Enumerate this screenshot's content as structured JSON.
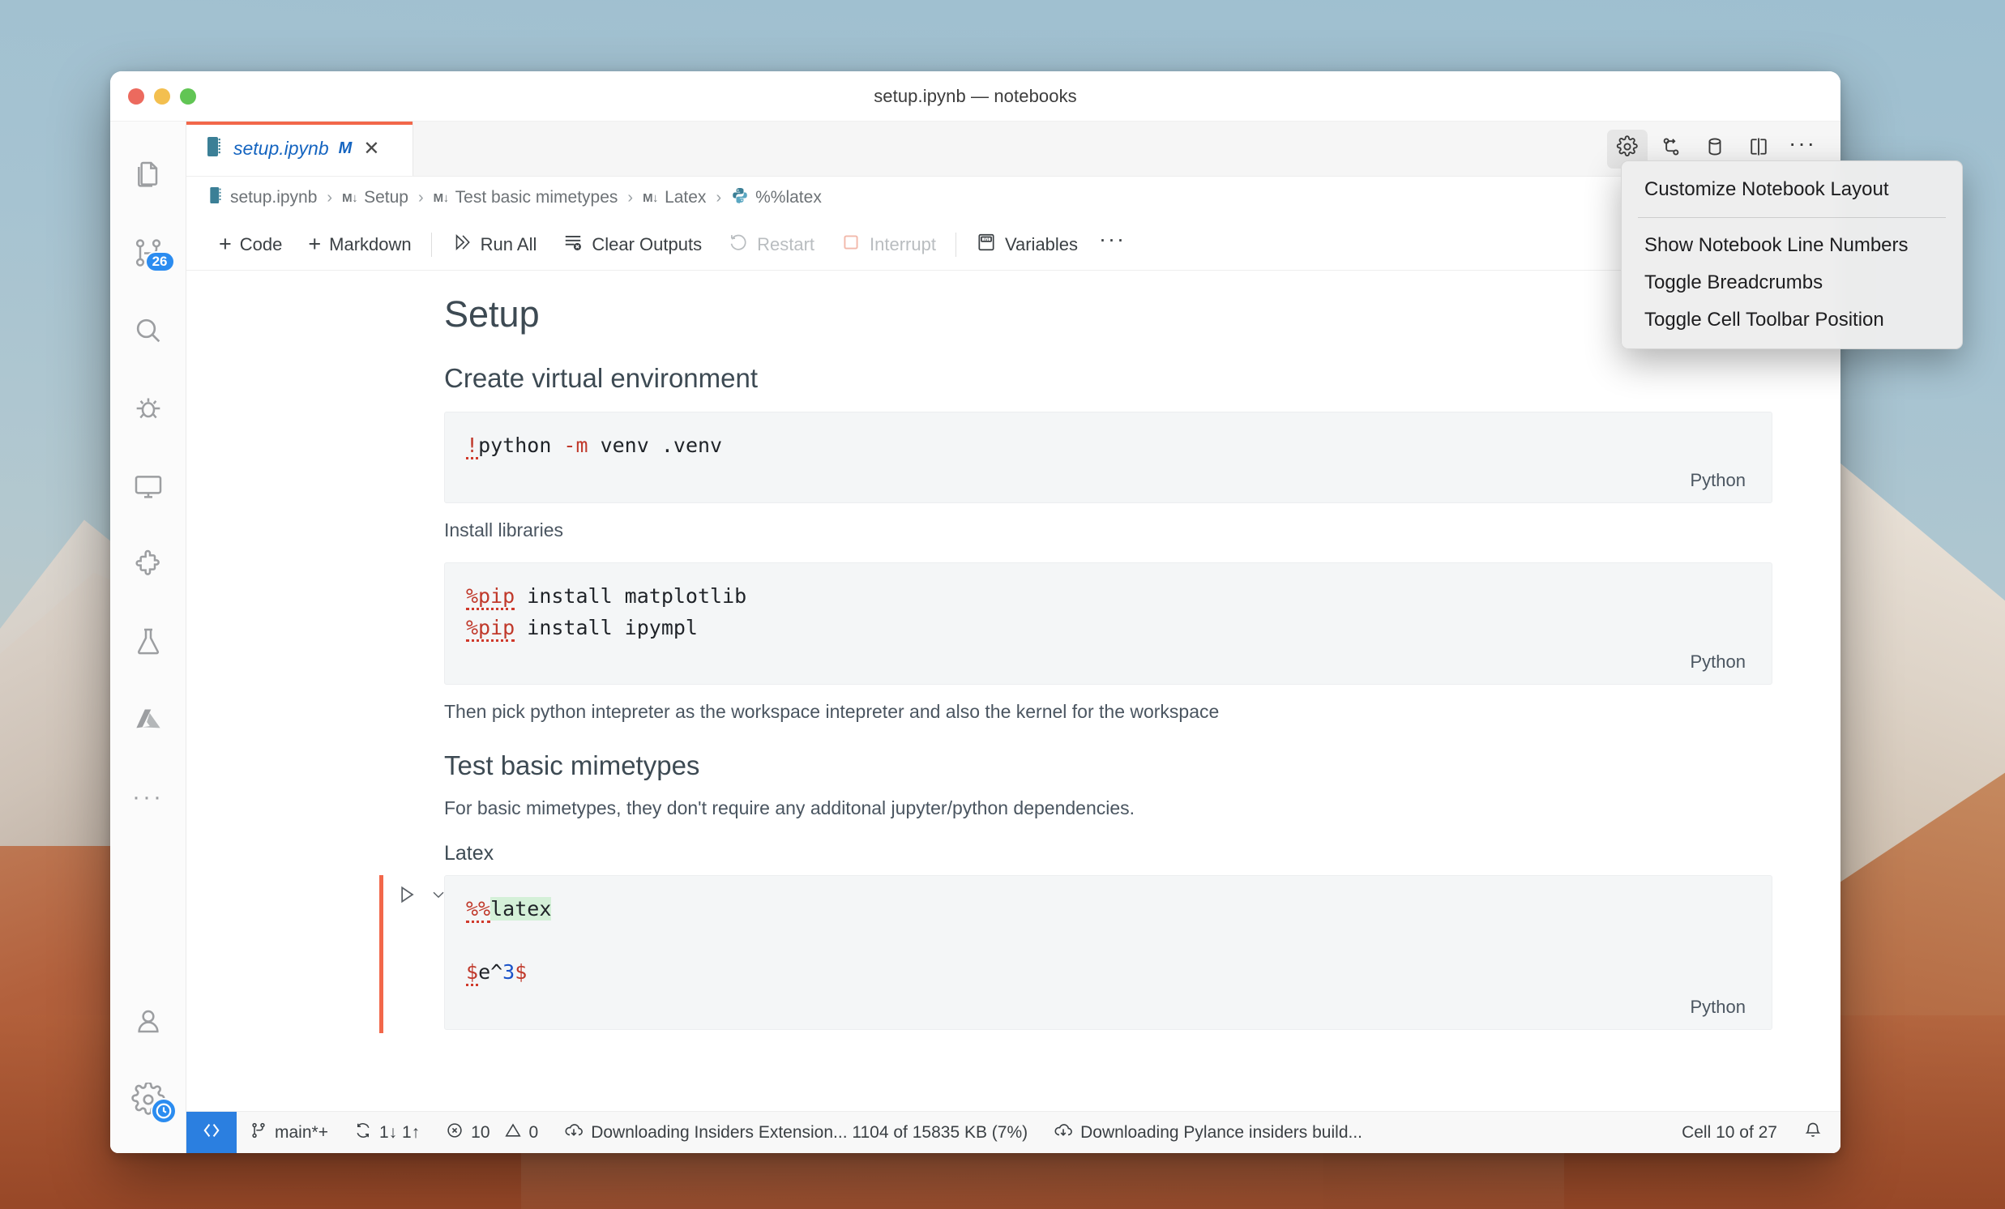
{
  "window": {
    "title": "setup.ipynb — notebooks",
    "traffic_lights": [
      "close-red",
      "minimize-yellow",
      "maximize-green"
    ]
  },
  "activity_bar": {
    "items": [
      {
        "name": "explorer",
        "icon": "files-icon",
        "badge": null
      },
      {
        "name": "source-control",
        "icon": "source-control-icon",
        "badge": "26"
      },
      {
        "name": "search",
        "icon": "search-icon",
        "badge": null
      },
      {
        "name": "run-and-debug",
        "icon": "debug-icon",
        "badge": null
      },
      {
        "name": "remote-explorer",
        "icon": "monitor-icon",
        "badge": null
      },
      {
        "name": "extensions",
        "icon": "extensions-icon",
        "badge": null
      },
      {
        "name": "testing",
        "icon": "beaker-icon",
        "badge": null
      },
      {
        "name": "azure",
        "icon": "azure-icon",
        "badge": null
      },
      {
        "name": "more-views",
        "icon": "ellipsis-icon",
        "badge": null
      }
    ],
    "bottom_items": [
      {
        "name": "accounts",
        "icon": "account-icon"
      },
      {
        "name": "manage-settings",
        "icon": "gear-icon",
        "overlay": "clock-icon"
      }
    ]
  },
  "tabs": [
    {
      "label": "setup.ipynb",
      "dirty_indicator": "M",
      "close": "✕",
      "icon": "notebook-icon",
      "active": true
    }
  ],
  "tab_actions": [
    {
      "name": "notebook-settings",
      "icon": "gear-icon",
      "active": true
    },
    {
      "name": "split-diff",
      "icon": "git-compare-icon",
      "active": false
    },
    {
      "name": "run-by-line",
      "icon": "database-icon",
      "active": false
    },
    {
      "name": "split-editor",
      "icon": "split-editor-icon",
      "active": false
    },
    {
      "name": "more-actions",
      "icon": "ellipsis-icon",
      "active": false
    }
  ],
  "breadcrumbs": [
    {
      "label": "setup.ipynb",
      "icon": "notebook-icon"
    },
    {
      "label": "Setup",
      "icon": "markdown-icon"
    },
    {
      "label": "Test basic mimetypes",
      "icon": "markdown-icon"
    },
    {
      "label": "Latex",
      "icon": "markdown-icon"
    },
    {
      "label": "%%latex",
      "icon": "python-icon"
    }
  ],
  "breadcrumb_separator": "›",
  "notebook_toolbar": {
    "buttons": [
      {
        "label": "Code",
        "icon": "plus-icon",
        "disabled": false
      },
      {
        "label": "Markdown",
        "icon": "plus-icon",
        "disabled": false
      },
      {
        "label": "Run All",
        "icon": "run-all-icon",
        "disabled": false
      },
      {
        "label": "Clear Outputs",
        "icon": "clear-outputs-icon",
        "disabled": false
      },
      {
        "label": "Restart",
        "icon": "restart-icon",
        "disabled": true
      },
      {
        "label": "Interrupt",
        "icon": "interrupt-icon",
        "disabled": true
      },
      {
        "label": "Variables",
        "icon": "variables-icon",
        "disabled": false
      }
    ],
    "overflow": "…"
  },
  "notebook": {
    "h1": "Setup",
    "h2_create_venv": "Create virtual environment",
    "cell1": {
      "code_prefix": "!",
      "code_body": "python ",
      "code_flag": "-m",
      "code_rest": " venv .venv",
      "language": "Python"
    },
    "p_install": "Install libraries",
    "cell2": {
      "line1_magic": "%pip",
      "line1_rest": " install matplotlib",
      "line2_magic": "%pip",
      "line2_rest": " install ipympl",
      "language": "Python"
    },
    "p_pick_interpreter": "Then pick python intepreter as the workspace intepreter and also the kernel for the workspace",
    "h2_test_mimetypes": "Test basic mimetypes",
    "p_basic_mimetypes": "For basic mimetypes, they don't require any additonal jupyter/python dependencies.",
    "h3_latex": "Latex",
    "cell3": {
      "magic_percent": "%%",
      "magic_name": "latex",
      "expr_open": "$",
      "expr_body": "e^",
      "expr_num": "3",
      "expr_close": "$",
      "language": "Python"
    }
  },
  "context_menu": {
    "items": [
      {
        "label": "Customize Notebook Layout",
        "separator_after": true
      },
      {
        "label": "Show Notebook Line Numbers",
        "separator_after": false
      },
      {
        "label": "Toggle Breadcrumbs",
        "separator_after": false
      },
      {
        "label": "Toggle Cell Toolbar Position",
        "separator_after": false
      }
    ]
  },
  "status_bar": {
    "remote_icon": "remote-window-icon",
    "branch": "main*+",
    "sync": "1↓ 1↑",
    "errors": "10",
    "warnings": "0",
    "download_1": "Downloading Insiders Extension... 1104 of 15835 KB (7%)",
    "download_2": "Downloading Pylance insiders build...",
    "cell_position": "Cell 10 of 27",
    "bell_icon": "bell-icon"
  },
  "colors": {
    "accent_blue": "#2b7fe0",
    "tab_active_border": "#f2674a",
    "link_blue": "#1464c0",
    "magic_red": "#c0392b",
    "number_blue": "#1a53c9",
    "highlight_green": "#d4f0d8",
    "badge_blue": "#2b8cf0"
  }
}
